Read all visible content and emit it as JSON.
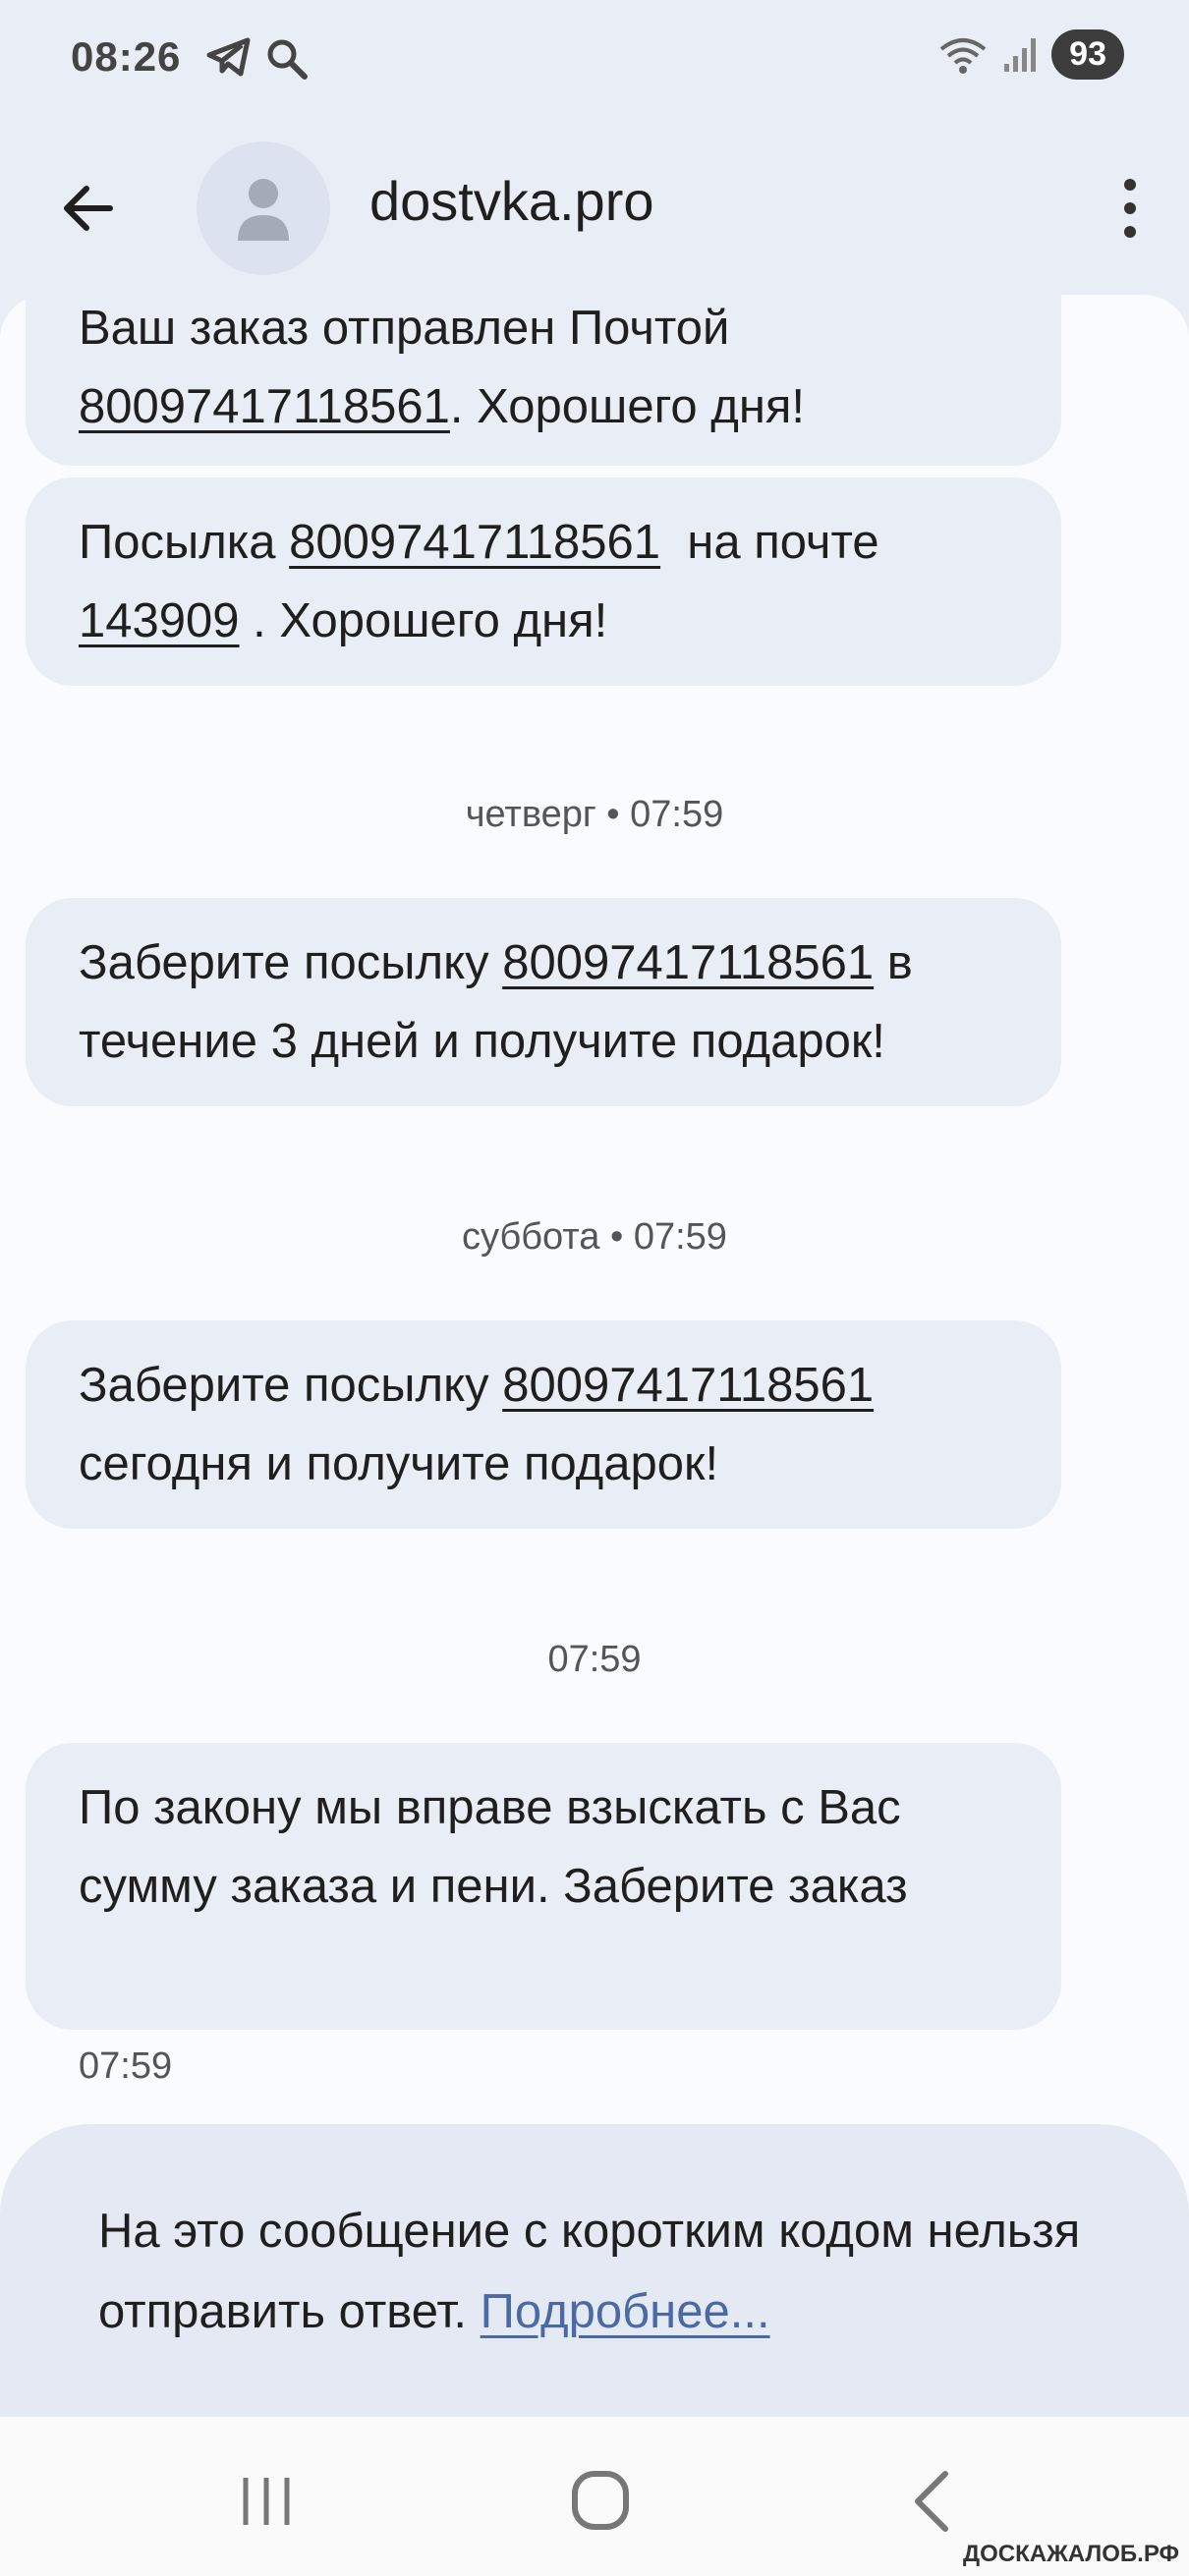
{
  "status_bar": {
    "time": "08:26",
    "battery": "93",
    "icons": [
      "telegram-icon",
      "search-icon",
      "wifi-icon",
      "signal-icon"
    ]
  },
  "header": {
    "title": "dostvka.pro"
  },
  "messages": [
    {
      "parts": [
        "Ваш заказ отправлен Почтой ",
        "80097417118561",
        ". Хорошего дня!"
      ]
    },
    {
      "parts": [
        "Посылка ",
        "80097417118561",
        "  на почте ",
        "143909",
        " . Хорошего дня!"
      ]
    },
    {
      "date": "четверг • 07:59",
      "parts": [
        "Заберите посылку ",
        "80097417118561",
        " в течение 3 дней и получите подарок!"
      ]
    },
    {
      "date": "суббота • 07:59",
      "parts": [
        "Заберите посылку ",
        "80097417118561",
        " сегодня и получите подарок!"
      ]
    },
    {
      "date": "07:59",
      "text": "По закону мы вправе взыскать с Вас сумму заказа и пени. Заберите заказ",
      "time": "07:59"
    }
  ],
  "reply_notice": {
    "text": "На это сообщение с коротким кодом нельзя отправить ответ. ",
    "link": "Подробнее..."
  },
  "watermark": "ДОСКАЖАЛОБ.РФ",
  "colors": {
    "background": "#e9edf6",
    "bubble": "#e9edf6",
    "conversation": "#fafbfe",
    "link": "#4a6aa5"
  }
}
